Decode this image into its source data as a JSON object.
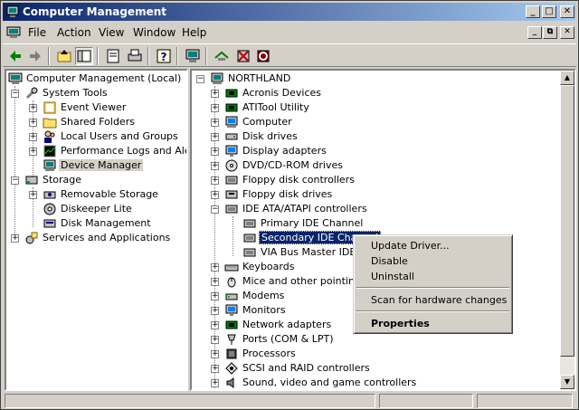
{
  "window": {
    "title": "Computer Management"
  },
  "menu": {
    "file": "File",
    "action": "Action",
    "view": "View",
    "window": "Window",
    "help": "Help"
  },
  "left_tree": [
    {
      "label": "Computer Management (Local)",
      "icon": "computer-management-icon"
    },
    {
      "label": "System Tools",
      "icon": "tools-icon"
    },
    {
      "label": "Event Viewer",
      "icon": "event-viewer-icon"
    },
    {
      "label": "Shared Folders",
      "icon": "folder-icon"
    },
    {
      "label": "Local Users and Groups",
      "icon": "users-icon"
    },
    {
      "label": "Performance Logs and Alerts",
      "icon": "performance-icon"
    },
    {
      "label": "Device Manager",
      "icon": "device-manager-icon"
    },
    {
      "label": "Storage",
      "icon": "storage-icon"
    },
    {
      "label": "Removable Storage",
      "icon": "removable-storage-icon"
    },
    {
      "label": "Diskeeper Lite",
      "icon": "diskeeper-icon"
    },
    {
      "label": "Disk Management",
      "icon": "disk-management-icon"
    },
    {
      "label": "Services and Applications",
      "icon": "services-icon"
    }
  ],
  "right_tree": [
    {
      "label": "NORTHLAND",
      "icon": "computer-icon"
    },
    {
      "label": "Acronis Devices",
      "icon": "chip-icon"
    },
    {
      "label": "ATITool Utility",
      "icon": "chip-icon"
    },
    {
      "label": "Computer",
      "icon": "computer-icon"
    },
    {
      "label": "Disk drives",
      "icon": "disk-icon"
    },
    {
      "label": "Display adapters",
      "icon": "monitor-icon"
    },
    {
      "label": "DVD/CD-ROM drives",
      "icon": "cdrom-icon"
    },
    {
      "label": "Floppy disk controllers",
      "icon": "controller-icon"
    },
    {
      "label": "Floppy disk drives",
      "icon": "floppy-icon"
    },
    {
      "label": "IDE ATA/ATAPI controllers",
      "icon": "controller-icon"
    },
    {
      "label": "Primary IDE Channel",
      "icon": "controller-icon"
    },
    {
      "label": "Secondary IDE Channel",
      "icon": "controller-icon"
    },
    {
      "label": "VIA Bus Master IDE C",
      "icon": "controller-icon"
    },
    {
      "label": "Keyboards",
      "icon": "keyboard-icon"
    },
    {
      "label": "Mice and other pointing d",
      "icon": "mouse-icon"
    },
    {
      "label": "Modems",
      "icon": "modem-icon"
    },
    {
      "label": "Monitors",
      "icon": "monitor-icon"
    },
    {
      "label": "Network adapters",
      "icon": "network-icon"
    },
    {
      "label": "Ports (COM & LPT)",
      "icon": "port-icon"
    },
    {
      "label": "Processors",
      "icon": "processor-icon"
    },
    {
      "label": "SCSI and RAID controllers",
      "icon": "scsi-icon"
    },
    {
      "label": "Sound, video and game controllers",
      "icon": "sound-icon"
    }
  ],
  "context_menu": {
    "update_driver": "Update Driver...",
    "disable": "Disable",
    "uninstall": "Uninstall",
    "scan": "Scan for hardware changes",
    "properties": "Properties"
  },
  "colors": {
    "titlebar_start": "#0a246a",
    "titlebar_end": "#a6caf0",
    "selection": "#0a246a",
    "face": "#d4d0c8"
  }
}
